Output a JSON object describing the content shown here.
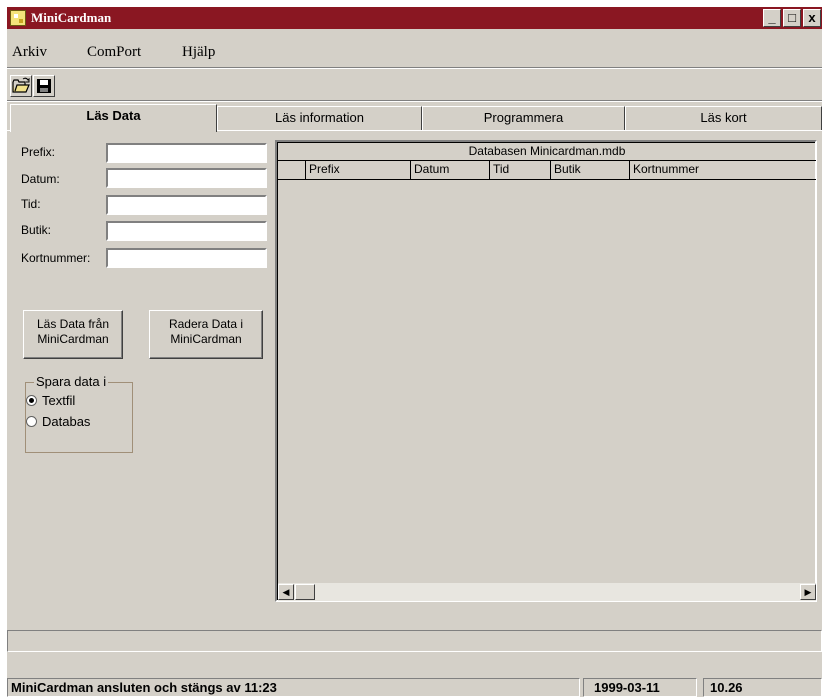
{
  "window": {
    "title": "MiniCardman"
  },
  "caption_buttons": {
    "minimize": "_",
    "maximize": "□",
    "close": "x"
  },
  "menu": [
    "Arkiv",
    "ComPort",
    "Hjälp"
  ],
  "toolbar": {
    "open_icon": "folder-open-icon",
    "save_icon": "floppy-disk-icon"
  },
  "tabs": [
    "Läs Data",
    "Läs information",
    "Programmera",
    "Läs kort"
  ],
  "form": {
    "fields": [
      {
        "label": "Prefix:",
        "value": ""
      },
      {
        "label": "Datum:",
        "value": ""
      },
      {
        "label": "Tid:",
        "value": ""
      },
      {
        "label": "Butik:",
        "value": ""
      },
      {
        "label": "Kortnummer:",
        "value": ""
      }
    ]
  },
  "buttons": {
    "read": "Läs Data från\nMiniCardman",
    "erase": "Radera Data i\nMiniCardman"
  },
  "save_group": {
    "title": "Spara data i",
    "options": [
      "Textfil",
      "Databas"
    ],
    "selected": "Textfil"
  },
  "grid": {
    "caption": "Databasen Minicardman.mdb",
    "columns": [
      "Prefix",
      "Datum",
      "Tid",
      "Butik",
      "Kortnummer"
    ]
  },
  "status": {
    "message": "MiniCardman ansluten och stängs av 11:23",
    "date": "1999-03-11",
    "time": "10.26"
  }
}
